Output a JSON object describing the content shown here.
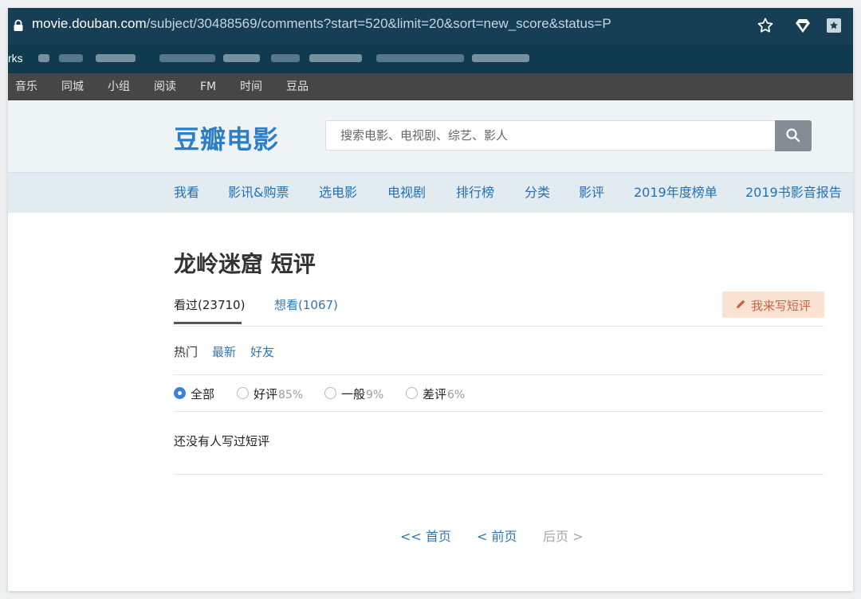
{
  "browser": {
    "url_host": "movie.douban.com",
    "url_path": "/subject/30488569/comments?start=520&limit=20&sort=new_score&status=P",
    "bookmarks_label": "rks"
  },
  "global_nav": [
    "音乐",
    "同城",
    "小组",
    "阅读",
    "FM",
    "时间",
    "豆品"
  ],
  "header": {
    "logo": "豆瓣电影",
    "search_placeholder": "搜索电影、电视剧、综艺、影人"
  },
  "sub_nav": [
    "我看",
    "影讯&购票",
    "选电影",
    "电视剧",
    "排行榜",
    "分类",
    "影评",
    "2019年度榜单",
    "2019书影音报告"
  ],
  "page": {
    "title": "龙岭迷窟 短评",
    "tabs": [
      {
        "label": "看过(23710)",
        "active": true
      },
      {
        "label": "想看(1067)",
        "active": false
      }
    ],
    "write_button": "我来写短评",
    "sort_options": [
      {
        "label": "热门",
        "current": true
      },
      {
        "label": "最新",
        "current": false
      },
      {
        "label": "好友",
        "current": false
      }
    ],
    "filters": [
      {
        "label": "全部",
        "percent": "",
        "checked": true
      },
      {
        "label": "好评",
        "percent": "85%",
        "checked": false
      },
      {
        "label": "一般",
        "percent": "9%",
        "checked": false
      },
      {
        "label": "差评",
        "percent": "6%",
        "checked": false
      }
    ],
    "empty_message": "还没有人写过短评",
    "pagination": {
      "first": "<< 首页",
      "prev": "< 前页",
      "next": "后页 >"
    }
  },
  "colors": {
    "url_bar": "#163e55",
    "global_nav": "#464646",
    "link": "#3377aa",
    "logo": "#2c7ec8",
    "write_button_bg": "#fbe3d3",
    "radio_checked": "#3b82d8"
  }
}
